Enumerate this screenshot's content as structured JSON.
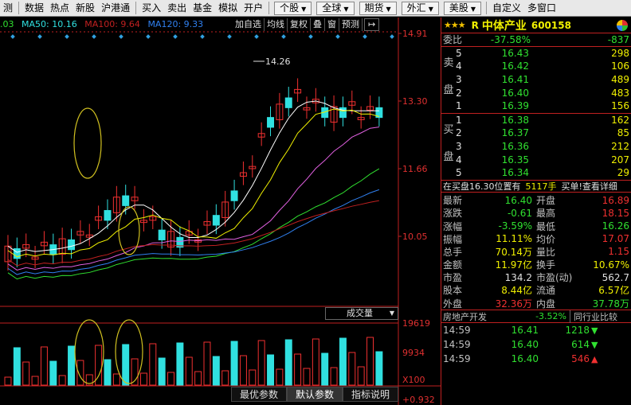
{
  "toolbar": {
    "cut_label": "测",
    "items": [
      "数据",
      "热点",
      "新股",
      "沪港通",
      "买入",
      "卖出",
      "基金",
      "模拟",
      "开户"
    ],
    "dropdowns": [
      "个股",
      "全球",
      "期货",
      "外汇",
      "美股"
    ],
    "right_items": [
      "自定义",
      "多窗口"
    ]
  },
  "ma_bar": {
    "prefix": ".03",
    "ma50": "MA50: 10.16",
    "ma100": "MA100: 9.64",
    "ma120": "MA120: 9.33"
  },
  "chart_tools": [
    "加自选",
    "均线",
    "复权",
    "叠",
    "窗",
    "预测"
  ],
  "chart_tool_arrow": "↦",
  "price_axis": [
    "14.91",
    "13.30",
    "11.66",
    "10.05"
  ],
  "high_annotation": "14.26",
  "volume_axis": [
    "19619",
    "9934",
    "X100"
  ],
  "volume_panel": {
    "title": "成交量"
  },
  "bottom_left_value": "+0.932",
  "bottom_buttons": [
    "最优参数",
    "默认参数",
    "指标说明"
  ],
  "colors": {
    "up": "#f03030",
    "down": "#30e0e0",
    "ma_white": "#ffffff",
    "ma_yellow": "#f0f000",
    "ma_magenta": "#e060e0",
    "ma_green": "#30e030",
    "ma_blue": "#3080f0",
    "ma_red": "#c02020"
  },
  "stock": {
    "stars": "★★★",
    "mark": "R",
    "name": "中体产业",
    "code": "600158"
  },
  "weibi": {
    "label": "委比",
    "pct": "-37.58%",
    "diff": "-837"
  },
  "sell_side_label": [
    "卖",
    "盘"
  ],
  "buy_side_label": [
    "买",
    "盘"
  ],
  "sell": [
    {
      "n": "5",
      "price": "16.43",
      "vol": "298"
    },
    {
      "n": "4",
      "price": "16.42",
      "vol": "106"
    },
    {
      "n": "3",
      "price": "16.41",
      "vol": "489"
    },
    {
      "n": "2",
      "price": "16.40",
      "vol": "483"
    },
    {
      "n": "1",
      "price": "16.39",
      "vol": "156"
    }
  ],
  "buy": [
    {
      "n": "1",
      "price": "16.38",
      "vol": "162"
    },
    {
      "n": "2",
      "price": "16.37",
      "vol": "85"
    },
    {
      "n": "3",
      "price": "16.36",
      "vol": "212"
    },
    {
      "n": "4",
      "price": "16.35",
      "vol": "207"
    },
    {
      "n": "5",
      "price": "16.34",
      "vol": "29"
    }
  ],
  "position_line": {
    "text": "在买盘16.30位置有",
    "qty": "5117手",
    "note": "买单!查看详细"
  },
  "quote": [
    {
      "k": "最新",
      "v": "16.40",
      "vc": "g",
      "k2": "开盘",
      "v2": "16.89",
      "v2c": "r"
    },
    {
      "k": "涨跌",
      "v": "-0.61",
      "vc": "g",
      "k2": "最高",
      "v2": "18.15",
      "v2c": "r"
    },
    {
      "k": "涨幅",
      "v": "-3.59%",
      "vc": "g",
      "k2": "最低",
      "v2": "16.26",
      "v2c": "g"
    },
    {
      "k": "振幅",
      "v": "11.11%",
      "vc": "y",
      "k2": "均价",
      "v2": "17.07",
      "v2c": "r"
    },
    {
      "k": "总手",
      "v": "70.14万",
      "vc": "y",
      "k2": "量比",
      "v2": "1.15",
      "v2c": "r"
    },
    {
      "k": "金额",
      "v": "11.97亿",
      "vc": "y",
      "k2": "换手",
      "v2": "10.67%",
      "v2c": "y"
    },
    {
      "k": "市盈",
      "v": "134.2",
      "vc": "w",
      "k2": "市盈(动)",
      "v2": "562.7",
      "v2c": "w"
    },
    {
      "k": "股本",
      "v": "8.44亿",
      "vc": "y",
      "k2": "流通",
      "v2": "6.57亿",
      "v2c": "y"
    },
    {
      "k": "外盘",
      "v": "32.36万",
      "vc": "r",
      "k2": "内盘",
      "v2": "37.78万",
      "v2c": "g"
    }
  ],
  "sector": {
    "name": "房地产开发",
    "pct": "-3.52%",
    "compare": "同行业比较"
  },
  "ticks": [
    {
      "time": "14:59",
      "price": "16.41",
      "vol": "1218",
      "dir": "down"
    },
    {
      "time": "14:59",
      "price": "16.40",
      "vol": "614",
      "dir": "down"
    },
    {
      "time": "14:59",
      "price": "16.40",
      "vol": "546",
      "dir": "up"
    }
  ]
}
